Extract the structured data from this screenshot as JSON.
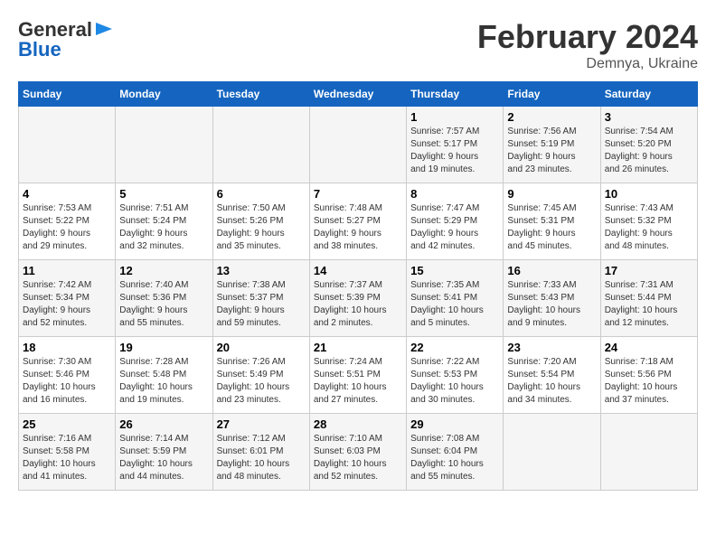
{
  "logo": {
    "line1": "General",
    "line2": "Blue"
  },
  "title": {
    "month_year": "February 2024",
    "location": "Demnya, Ukraine"
  },
  "weekdays": [
    "Sunday",
    "Monday",
    "Tuesday",
    "Wednesday",
    "Thursday",
    "Friday",
    "Saturday"
  ],
  "weeks": [
    [
      {
        "day": "",
        "info": ""
      },
      {
        "day": "",
        "info": ""
      },
      {
        "day": "",
        "info": ""
      },
      {
        "day": "",
        "info": ""
      },
      {
        "day": "1",
        "info": "Sunrise: 7:57 AM\nSunset: 5:17 PM\nDaylight: 9 hours\nand 19 minutes."
      },
      {
        "day": "2",
        "info": "Sunrise: 7:56 AM\nSunset: 5:19 PM\nDaylight: 9 hours\nand 23 minutes."
      },
      {
        "day": "3",
        "info": "Sunrise: 7:54 AM\nSunset: 5:20 PM\nDaylight: 9 hours\nand 26 minutes."
      }
    ],
    [
      {
        "day": "4",
        "info": "Sunrise: 7:53 AM\nSunset: 5:22 PM\nDaylight: 9 hours\nand 29 minutes."
      },
      {
        "day": "5",
        "info": "Sunrise: 7:51 AM\nSunset: 5:24 PM\nDaylight: 9 hours\nand 32 minutes."
      },
      {
        "day": "6",
        "info": "Sunrise: 7:50 AM\nSunset: 5:26 PM\nDaylight: 9 hours\nand 35 minutes."
      },
      {
        "day": "7",
        "info": "Sunrise: 7:48 AM\nSunset: 5:27 PM\nDaylight: 9 hours\nand 38 minutes."
      },
      {
        "day": "8",
        "info": "Sunrise: 7:47 AM\nSunset: 5:29 PM\nDaylight: 9 hours\nand 42 minutes."
      },
      {
        "day": "9",
        "info": "Sunrise: 7:45 AM\nSunset: 5:31 PM\nDaylight: 9 hours\nand 45 minutes."
      },
      {
        "day": "10",
        "info": "Sunrise: 7:43 AM\nSunset: 5:32 PM\nDaylight: 9 hours\nand 48 minutes."
      }
    ],
    [
      {
        "day": "11",
        "info": "Sunrise: 7:42 AM\nSunset: 5:34 PM\nDaylight: 9 hours\nand 52 minutes."
      },
      {
        "day": "12",
        "info": "Sunrise: 7:40 AM\nSunset: 5:36 PM\nDaylight: 9 hours\nand 55 minutes."
      },
      {
        "day": "13",
        "info": "Sunrise: 7:38 AM\nSunset: 5:37 PM\nDaylight: 9 hours\nand 59 minutes."
      },
      {
        "day": "14",
        "info": "Sunrise: 7:37 AM\nSunset: 5:39 PM\nDaylight: 10 hours\nand 2 minutes."
      },
      {
        "day": "15",
        "info": "Sunrise: 7:35 AM\nSunset: 5:41 PM\nDaylight: 10 hours\nand 5 minutes."
      },
      {
        "day": "16",
        "info": "Sunrise: 7:33 AM\nSunset: 5:43 PM\nDaylight: 10 hours\nand 9 minutes."
      },
      {
        "day": "17",
        "info": "Sunrise: 7:31 AM\nSunset: 5:44 PM\nDaylight: 10 hours\nand 12 minutes."
      }
    ],
    [
      {
        "day": "18",
        "info": "Sunrise: 7:30 AM\nSunset: 5:46 PM\nDaylight: 10 hours\nand 16 minutes."
      },
      {
        "day": "19",
        "info": "Sunrise: 7:28 AM\nSunset: 5:48 PM\nDaylight: 10 hours\nand 19 minutes."
      },
      {
        "day": "20",
        "info": "Sunrise: 7:26 AM\nSunset: 5:49 PM\nDaylight: 10 hours\nand 23 minutes."
      },
      {
        "day": "21",
        "info": "Sunrise: 7:24 AM\nSunset: 5:51 PM\nDaylight: 10 hours\nand 27 minutes."
      },
      {
        "day": "22",
        "info": "Sunrise: 7:22 AM\nSunset: 5:53 PM\nDaylight: 10 hours\nand 30 minutes."
      },
      {
        "day": "23",
        "info": "Sunrise: 7:20 AM\nSunset: 5:54 PM\nDaylight: 10 hours\nand 34 minutes."
      },
      {
        "day": "24",
        "info": "Sunrise: 7:18 AM\nSunset: 5:56 PM\nDaylight: 10 hours\nand 37 minutes."
      }
    ],
    [
      {
        "day": "25",
        "info": "Sunrise: 7:16 AM\nSunset: 5:58 PM\nDaylight: 10 hours\nand 41 minutes."
      },
      {
        "day": "26",
        "info": "Sunrise: 7:14 AM\nSunset: 5:59 PM\nDaylight: 10 hours\nand 44 minutes."
      },
      {
        "day": "27",
        "info": "Sunrise: 7:12 AM\nSunset: 6:01 PM\nDaylight: 10 hours\nand 48 minutes."
      },
      {
        "day": "28",
        "info": "Sunrise: 7:10 AM\nSunset: 6:03 PM\nDaylight: 10 hours\nand 52 minutes."
      },
      {
        "day": "29",
        "info": "Sunrise: 7:08 AM\nSunset: 6:04 PM\nDaylight: 10 hours\nand 55 minutes."
      },
      {
        "day": "",
        "info": ""
      },
      {
        "day": "",
        "info": ""
      }
    ]
  ]
}
